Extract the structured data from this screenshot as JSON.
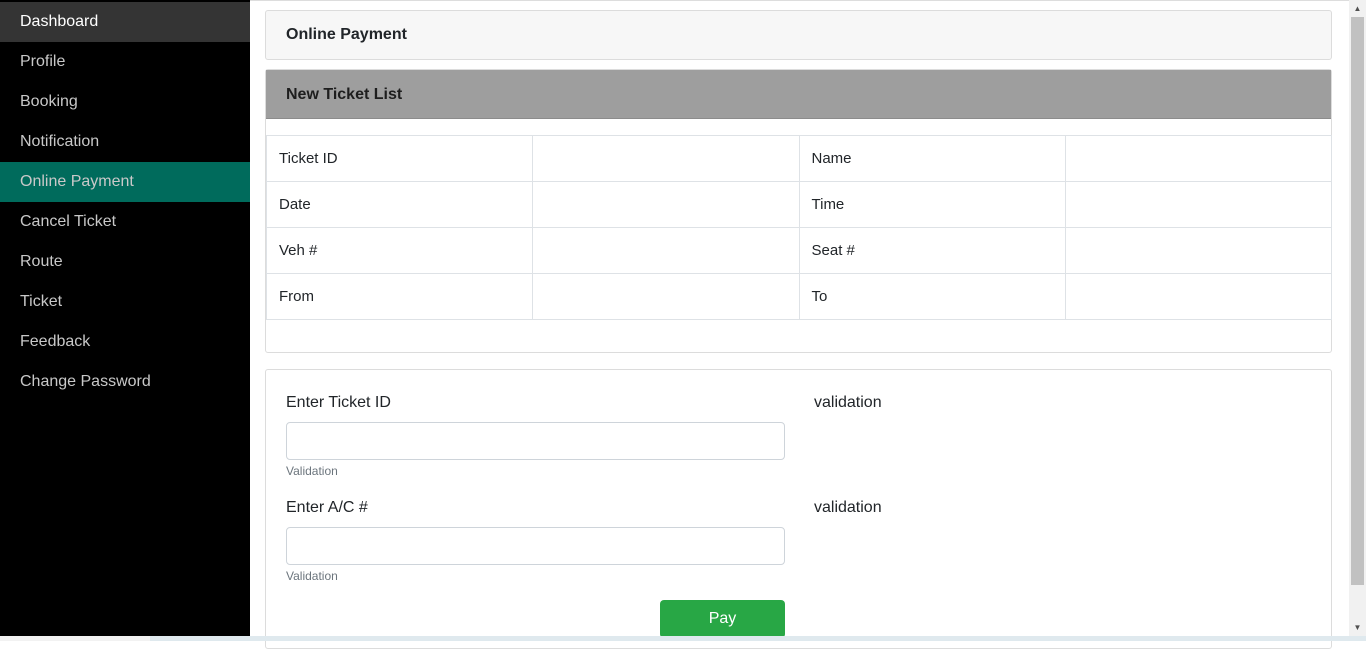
{
  "sidebar": {
    "items": [
      {
        "label": "Dashboard"
      },
      {
        "label": "Profile"
      },
      {
        "label": "Booking"
      },
      {
        "label": "Notification"
      },
      {
        "label": "Online Payment"
      },
      {
        "label": "Cancel Ticket"
      },
      {
        "label": "Route"
      },
      {
        "label": "Ticket"
      },
      {
        "label": "Feedback"
      },
      {
        "label": "Change Password"
      }
    ],
    "active_color": "#006b5c"
  },
  "header": {
    "title": "Online Payment"
  },
  "ticket_list": {
    "title": "New Ticket List",
    "rows": [
      {
        "label1": "Ticket ID",
        "value1": "",
        "label2": "Name",
        "value2": ""
      },
      {
        "label1": "Date",
        "value1": "",
        "label2": "Time",
        "value2": ""
      },
      {
        "label1": "Veh #",
        "value1": "",
        "label2": "Seat #",
        "value2": ""
      },
      {
        "label1": "From",
        "value1": "",
        "label2": "To",
        "value2": ""
      }
    ]
  },
  "form": {
    "ticket_id": {
      "label": "Enter Ticket ID",
      "value": "",
      "help": "Validation",
      "side_validation": "validation"
    },
    "account": {
      "label": "Enter A/C #",
      "value": "",
      "help": "Validation",
      "side_validation": "validation"
    },
    "pay_label": "Pay",
    "pay_color": "#28a745"
  }
}
